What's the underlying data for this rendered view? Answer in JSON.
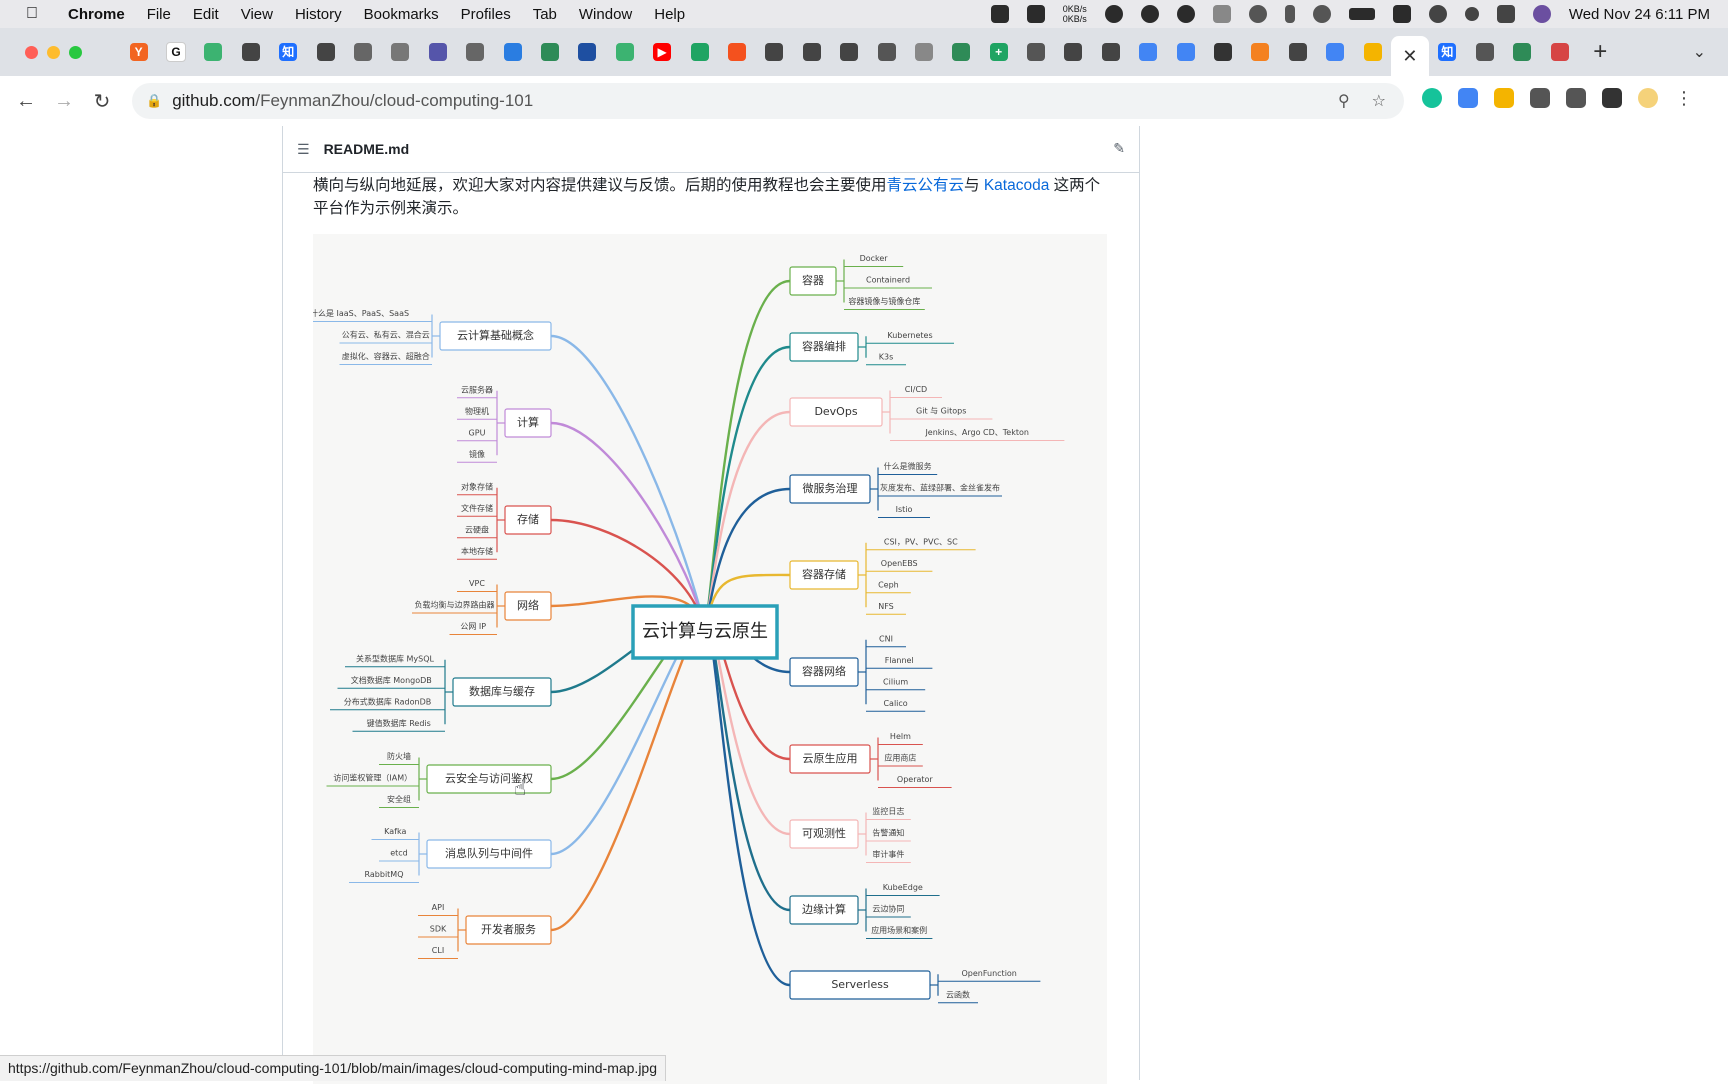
{
  "menubar": {
    "app": "Chrome",
    "items": [
      "File",
      "Edit",
      "View",
      "History",
      "Bookmarks",
      "Profiles",
      "Tab",
      "Window",
      "Help"
    ],
    "netspeed_up": "0KB/s",
    "netspeed_down": "0KB/s",
    "clock": "Wed Nov 24  6:11 PM"
  },
  "tabs": [
    {
      "icon": "y-combinator-icon",
      "glyph": "Y",
      "color": "#f26522"
    },
    {
      "icon": "google-icon",
      "glyph": "G",
      "color": "#ffffff"
    },
    {
      "icon": "layers-icon",
      "glyph": "",
      "color": "#3cb371"
    },
    {
      "icon": "github-icon",
      "glyph": "",
      "color": "#444444"
    },
    {
      "icon": "zhihu-icon",
      "glyph": "知",
      "color": "#1e6fff"
    },
    {
      "icon": "github-icon",
      "glyph": "",
      "color": "#444444"
    },
    {
      "icon": "globe-icon",
      "glyph": "",
      "color": "#666666"
    },
    {
      "icon": "document-icon",
      "glyph": "",
      "color": "#777777"
    },
    {
      "icon": "globe-icon",
      "glyph": "",
      "color": "#5555aa"
    },
    {
      "icon": "gear-icon",
      "glyph": "",
      "color": "#666666"
    },
    {
      "icon": "refresh-icon",
      "glyph": "",
      "color": "#2a7de1"
    },
    {
      "icon": "shield-icon",
      "glyph": "",
      "color": "#2e8b57"
    },
    {
      "icon": "crop-icon",
      "glyph": "",
      "color": "#1e4fa1"
    },
    {
      "icon": "layers-icon",
      "glyph": "",
      "color": "#3cb371"
    },
    {
      "icon": "youtube-icon",
      "glyph": "▶",
      "color": "#ff0000"
    },
    {
      "icon": "sheets-icon",
      "glyph": "",
      "color": "#1fa463"
    },
    {
      "icon": "slides-icon",
      "glyph": "",
      "color": "#f4511e"
    },
    {
      "icon": "github-icon",
      "glyph": "",
      "color": "#444444"
    },
    {
      "icon": "github-icon",
      "glyph": "",
      "color": "#444444"
    },
    {
      "icon": "github-icon",
      "glyph": "",
      "color": "#444444"
    },
    {
      "icon": "print-icon",
      "glyph": "",
      "color": "#555555"
    },
    {
      "icon": "notes-icon",
      "glyph": "",
      "color": "#888888"
    },
    {
      "icon": "gear-icon",
      "glyph": "",
      "color": "#2e8b57"
    },
    {
      "icon": "plus-box-icon",
      "glyph": "+",
      "color": "#1fa463"
    },
    {
      "icon": "globe-icon",
      "glyph": "",
      "color": "#555555"
    },
    {
      "icon": "github-icon",
      "glyph": "",
      "color": "#444444"
    },
    {
      "icon": "github-icon",
      "glyph": "",
      "color": "#444444"
    },
    {
      "icon": "docs-icon",
      "glyph": "",
      "color": "#4285f4"
    },
    {
      "icon": "docs-icon",
      "glyph": "",
      "color": "#4285f4"
    },
    {
      "icon": "file-icon",
      "glyph": "",
      "color": "#333333"
    },
    {
      "icon": "cloud-icon",
      "glyph": "",
      "color": "#f48120"
    },
    {
      "icon": "github-icon",
      "glyph": "",
      "color": "#444444"
    },
    {
      "icon": "docs-icon",
      "glyph": "",
      "color": "#4285f4"
    },
    {
      "icon": "slides-yellow-icon",
      "glyph": "",
      "color": "#f4b400"
    }
  ],
  "tabs_after": [
    {
      "icon": "zhihu-icon",
      "glyph": "知",
      "color": "#1e6fff"
    },
    {
      "icon": "bike-icon",
      "glyph": "",
      "color": "#555555"
    },
    {
      "icon": "shield-icon",
      "glyph": "",
      "color": "#2e8b57"
    },
    {
      "icon": "circle-icon",
      "glyph": "",
      "color": "#d64545"
    }
  ],
  "url": {
    "host": "github.com",
    "path": "/FeynmanZhou/cloud-computing-101"
  },
  "readme": {
    "filename": "README.md",
    "para_start": "横向与纵向地延展，欢迎大家对内容提供建议与反馈。后期的使用教程也会主要使用",
    "link1": "青云公有云",
    "mid": "与 ",
    "link2": "Katacoda",
    "para_end": " 这两个平台作为示例来演示。"
  },
  "mindmap": {
    "center": "云计算与云原生",
    "left": [
      {
        "label": "云计算基础概念",
        "color": "#8ab8e8",
        "leaves": [
          "什么是 IaaS、PaaS、SaaS",
          "公有云、私有云、混合云",
          "虚拟化、容器云、超融合"
        ]
      },
      {
        "label": "计算",
        "color": "#c08ad8",
        "leaves": [
          "云服务器",
          "物理机",
          "GPU",
          "镜像"
        ]
      },
      {
        "label": "存储",
        "color": "#d9534f",
        "leaves": [
          "对象存储",
          "文件存储",
          "云硬盘",
          "本地存储"
        ]
      },
      {
        "label": "网络",
        "color": "#e8843a",
        "leaves": [
          "VPC",
          "负载均衡与边界路由器",
          "公网 IP"
        ]
      },
      {
        "label": "数据库与缓存",
        "color": "#1f7a8c",
        "leaves": [
          "关系型数据库 MySQL",
          "文档数据库 MongoDB",
          "分布式数据库 RadonDB",
          "键值数据库 Redis"
        ]
      },
      {
        "label": "云安全与访问鉴权",
        "color": "#6ab04c",
        "leaves": [
          "防火墙",
          "访问鉴权管理（IAM）",
          "安全组"
        ]
      },
      {
        "label": "消息队列与中间件",
        "color": "#8ab8e8",
        "leaves": [
          "Kafka",
          "etcd",
          "RabbitMQ"
        ]
      },
      {
        "label": "开发者服务",
        "color": "#e8843a",
        "leaves": [
          "API",
          "SDK",
          "CLI"
        ]
      }
    ],
    "right": [
      {
        "label": "容器",
        "color": "#6ab04c",
        "leaves": [
          "Docker",
          "Containerd",
          "容器镜像与镜像仓库"
        ]
      },
      {
        "label": "容器编排",
        "color": "#1f8a8c",
        "leaves": [
          "Kubernetes",
          "K3s"
        ]
      },
      {
        "label": "DevOps",
        "color": "#f4b6b6",
        "leaves": [
          "CI/CD",
          "Git 与 Gitops",
          "Jenkins、Argo CD、Tekton"
        ]
      },
      {
        "label": "微服务治理",
        "color": "#1f5f99",
        "leaves": [
          "什么是微服务",
          "灰度发布、蓝绿部署、金丝雀发布",
          "Istio"
        ]
      },
      {
        "label": "容器存储",
        "color": "#e8b830",
        "leaves": [
          "CSI，PV、PVC、SC",
          "OpenEBS",
          "Ceph",
          "NFS"
        ]
      },
      {
        "label": "容器网络",
        "color": "#1f5f99",
        "leaves": [
          "CNI",
          "Flannel",
          "Cilium",
          "Calico"
        ]
      },
      {
        "label": "云原生应用",
        "color": "#d9534f",
        "leaves": [
          "Helm",
          "应用商店",
          "Operator"
        ]
      },
      {
        "label": "可观测性",
        "color": "#f4b6b6",
        "leaves": [
          "监控日志",
          "告警通知",
          "审计事件"
        ]
      },
      {
        "label": "边缘计算",
        "color": "#1f6f8c",
        "leaves": [
          "KubeEdge",
          "云边协同",
          "应用场景和案例"
        ]
      },
      {
        "label": "Serverless",
        "color": "#1f5f99",
        "leaves": [
          "OpenFunction",
          "云函数"
        ]
      }
    ]
  },
  "status_url": "https://github.com/FeynmanZhou/cloud-computing-101/blob/main/images/cloud-computing-mind-map.jpg"
}
